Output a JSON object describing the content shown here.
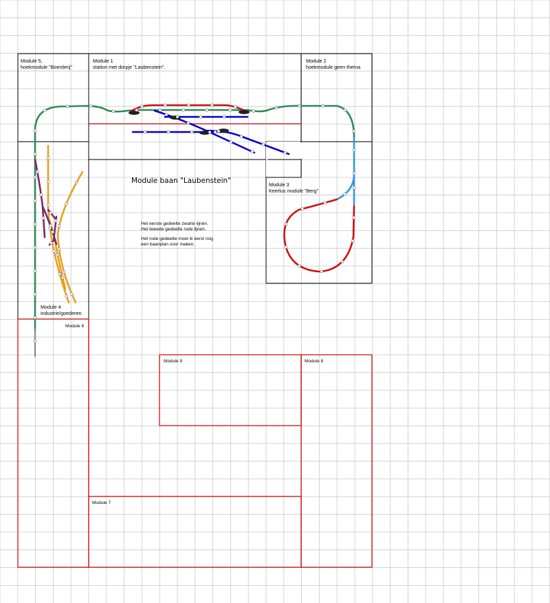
{
  "title": "Module baan \"Laubenstein\"",
  "modules": {
    "m5": {
      "line1": "Module 5,",
      "line2": "hoekmodule \"Boerderij\""
    },
    "m1": {
      "line1": "Module 1",
      "line2": "station met dorpje \"Laubenstein\"."
    },
    "m2": {
      "line1": "Module 2",
      "line2": "hoekmodule geen thema"
    },
    "m3": {
      "line1": "Module 3",
      "line2": "Keerlus module \"Berg\""
    },
    "m4": {
      "line1": "Module 4",
      "line2": "industrie/goederen."
    },
    "m6": {
      "line1": "Module 6"
    },
    "m7": {
      "line1": "Module 7"
    },
    "m8": {
      "line1": "Module 8"
    },
    "m9": {
      "line1": "Module 9"
    }
  },
  "notes": {
    "line1": "Het eerste gedeelte zwarte lijnen.",
    "line2": "Het tweede gedeelte rode lijnen.",
    "line3": "Het rode gedeelte moet ik eerst nog",
    "line4": "een baanplan voor maken."
  },
  "colors": {
    "grid": "#c8c8c8",
    "first_part_outline": "#000000",
    "second_part_outline": "#cc0000",
    "main_line": "#2e8b57",
    "station_track": "#0000cc",
    "red_track": "#cc1111",
    "light_blue_track": "#3399dd",
    "orange_track": "#e8a020",
    "purple_track": "#7a2a6a",
    "gray_track": "#888888"
  }
}
